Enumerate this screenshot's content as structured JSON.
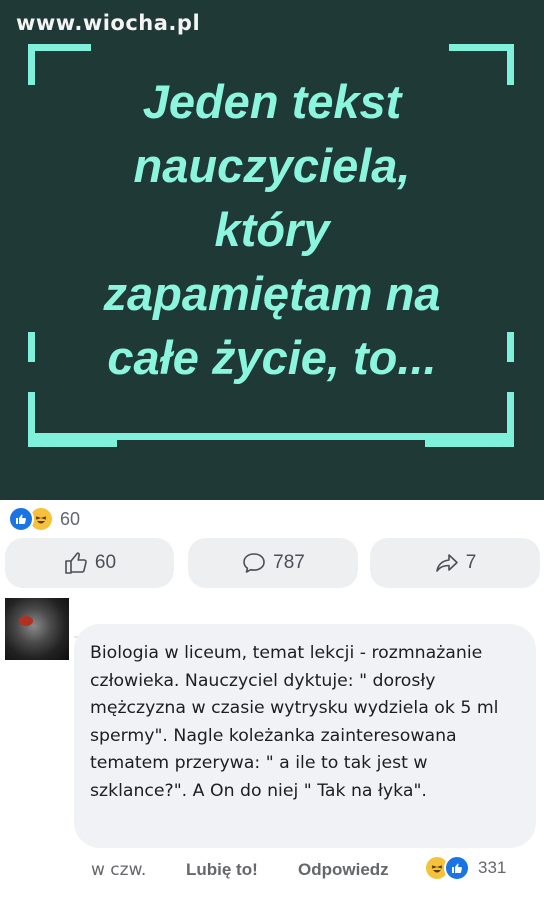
{
  "watermark": "www.wiocha.pl",
  "hero": {
    "lines": [
      "Jeden tekst",
      "nauczyciela,",
      "który",
      "zapamiętam na",
      "całe życie, to..."
    ],
    "text_color": "#8cf5dd",
    "bg_color": "#1f3936"
  },
  "post_reactions": {
    "count": "60",
    "icons": [
      "like-icon",
      "haha-icon"
    ]
  },
  "actions": {
    "like_count": "60",
    "comment_count": "787",
    "share_count": "7"
  },
  "comment": {
    "text": "Biologia w liceum, temat lekcji - rozmnażanie człowieka. Nauczyciel dyktuje: \" dorosły mężczyzna w czasie wytrysku wydziela ok 5 ml spermy\". Nagle koleżanka zainteresowana tematem przerywa: \" a ile to tak jest w szklance?\". A On do niej \" Tak na łyka\".",
    "time": "w czw.",
    "like_label": "Lubię to!",
    "reply_label": "Odpowiedz",
    "reaction_count": "331"
  }
}
